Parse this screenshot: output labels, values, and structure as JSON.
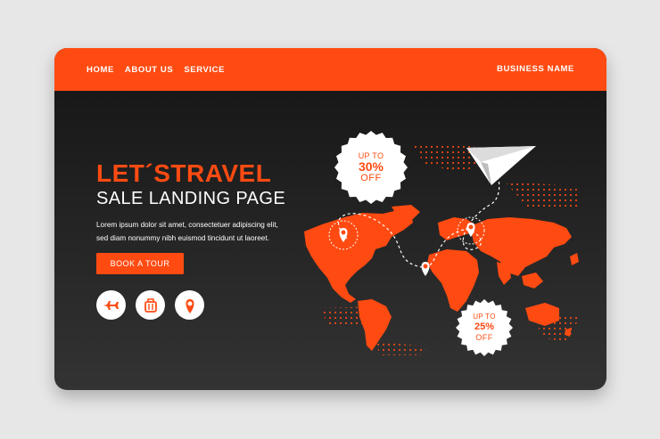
{
  "nav": {
    "items": [
      {
        "label": "HOME"
      },
      {
        "label": "ABOUT US"
      },
      {
        "label": "SERVICE"
      }
    ],
    "brand": "BUSINESS NAME"
  },
  "hero": {
    "title": "LET´STRAVEL",
    "subtitle": "SALE LANDING PAGE",
    "body_lines": [
      "Lorem ipsum dolor sit amet, consectetuer adipiscing elit,",
      "sed diam nonummy nibh euismod tincidunt ut laoreet."
    ],
    "cta_label": "BOOK A TOUR"
  },
  "icons": [
    "airplane-icon",
    "luggage-icon",
    "location-pin-icon"
  ],
  "badges": [
    {
      "line1": "UP TO",
      "line2": "30%",
      "line3": "OFF"
    },
    {
      "line1": "UP TO",
      "line2": "25%",
      "line3": "OFF"
    }
  ],
  "colors": {
    "accent": "#ff4b12",
    "background_top": "#141414",
    "background_bottom": "#333333",
    "text_light": "#ffffff"
  }
}
